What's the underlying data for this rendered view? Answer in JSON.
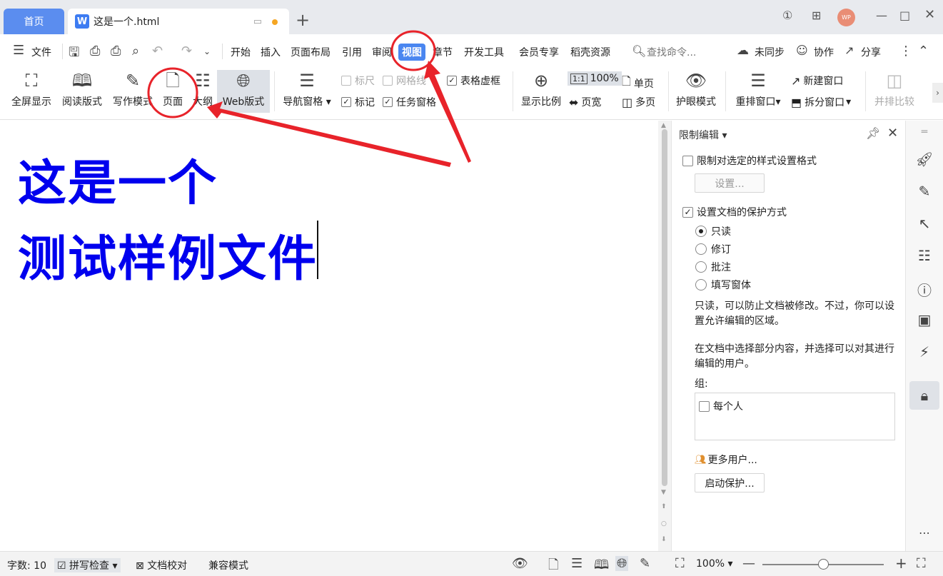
{
  "tabs": {
    "home": "首页",
    "doc_title": "这是一个.html",
    "logo_letter": "W",
    "avatar_text": "WP"
  },
  "menu": {
    "file": "文件",
    "items": [
      "开始",
      "插入",
      "页面布局",
      "引用",
      "审阅",
      "视图",
      "章节",
      "开发工具",
      "会员专享",
      "稻壳资源"
    ],
    "active": "视图",
    "search": "查找命令...",
    "unsync": "未同步",
    "collab": "协作",
    "share": "分享"
  },
  "ribbon": {
    "fullscreen": "全屏显示",
    "reading": "阅读版式",
    "writing": "写作模式",
    "page": "页面",
    "outline": "大纲",
    "web": "Web版式",
    "nav_pane": "导航窗格",
    "ruler": "标尺",
    "gridlines": "网格线",
    "table_gridlines": "表格虚框",
    "marks": "标记",
    "task_pane": "任务窗格",
    "zoom_label": "显示比例",
    "zoom_100": "100%",
    "single_page": "单页",
    "page_width": "页宽",
    "multi_page": "多页",
    "eye_mode": "护眼模式",
    "rearrange": "重排窗口",
    "new_window": "新建窗口",
    "split_window": "拆分窗口",
    "side_by_side": "并排比较"
  },
  "document": {
    "line1": "这是一个",
    "line2": "测试样例文件"
  },
  "panel": {
    "title": "限制编辑",
    "restrict_format": "限制对选定的样式设置格式",
    "settings_btn": "设置...",
    "set_protection": "设置文档的保护方式",
    "options": [
      "只读",
      "修订",
      "批注",
      "填写窗体"
    ],
    "selected_option": "只读",
    "desc1": "只读，可以防止文档被修改。不过，你可以设置允许编辑的区域。",
    "desc2": "在文档中选择部分内容，并选择可以对其进行编辑的用户。",
    "group_label": "组:",
    "everyone": "每个人",
    "more_users": "更多用户...",
    "start_protect": "启动保护..."
  },
  "status": {
    "word_count": "字数: 10",
    "spell_check": "拼写检查",
    "doc_proof": "文档校对",
    "compat_mode": "兼容模式",
    "zoom": "100%",
    "zoom_level": 0.5
  },
  "colors": {
    "accent": "#4a86f0",
    "doc_text": "#0000ee",
    "annotation": "#e8232a"
  }
}
